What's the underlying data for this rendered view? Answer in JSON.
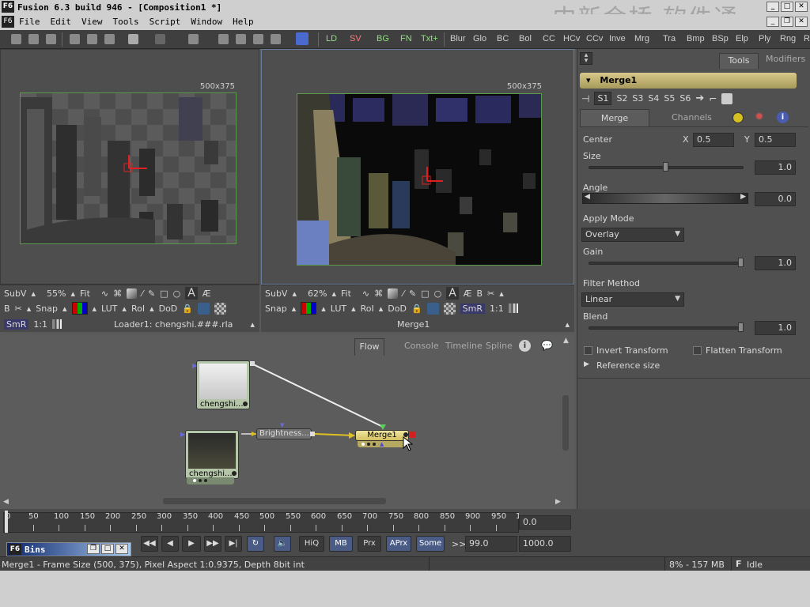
{
  "window": {
    "logo": "F6",
    "title": "Fusion 6.3 build 946 - [Composition1 *]",
    "watermark": "中新金桥  软件通"
  },
  "menu": {
    "logo": "F6",
    "items": [
      "File",
      "Edit",
      "View",
      "Tools",
      "Script",
      "Window",
      "Help"
    ]
  },
  "toolbar": {
    "green_tools": [
      "LD",
      "SV",
      "BG",
      "FN",
      "Txt+"
    ],
    "tools": [
      "Blur",
      "Glo",
      "BC",
      "Bol",
      "CC",
      "HCv",
      "CCv",
      "Inve",
      "Mrg",
      "Tra",
      "Bmp",
      "BSp",
      "Elp",
      "Ply",
      "Rng",
      "R"
    ]
  },
  "viewer_left": {
    "resolution": "500x375",
    "row1": {
      "subv": "SubV",
      "zoom": "55%",
      "fit": "Fit"
    },
    "row2": {
      "b": "B",
      "snap": "Snap",
      "lut": "LUT",
      "roi": "RoI",
      "dod": "DoD"
    },
    "row3": {
      "smr": "SmR",
      "one": "1:1",
      "name": "Loader1: chengshi.###.rla"
    }
  },
  "viewer_right": {
    "resolution": "500x375",
    "row1": {
      "subv": "SubV",
      "zoom": "62%",
      "fit": "Fit",
      "a": "A",
      "b": "B"
    },
    "row2": {
      "snap": "Snap",
      "lut": "LUT",
      "roi": "RoI",
      "dod": "DoD",
      "smr": "SmR",
      "one": "1:1"
    },
    "row3": {
      "name": "Merge1"
    }
  },
  "inspector": {
    "tabs": [
      "Tools",
      "Modifiers"
    ],
    "tool_name": "Merge1",
    "slots": [
      "S1",
      "S2",
      "S3",
      "S4",
      "S5",
      "S6"
    ],
    "subtabs": [
      "Merge",
      "Channels"
    ],
    "center": {
      "label": "Center",
      "x_label": "X",
      "x": "0.5",
      "y_label": "Y",
      "y": "0.5"
    },
    "size": {
      "label": "Size",
      "value": "1.0",
      "level": 0.5
    },
    "angle": {
      "label": "Angle",
      "value": "0.0"
    },
    "apply_mode": {
      "label": "Apply Mode",
      "value": "Overlay"
    },
    "gain": {
      "label": "Gain",
      "value": "1.0",
      "level": 1.0
    },
    "filter": {
      "label": "Filter Method",
      "value": "Linear"
    },
    "blend": {
      "label": "Blend",
      "value": "1.0",
      "level": 1.0
    },
    "invert": "Invert Transform",
    "flatten": "Flatten Transform",
    "refsize": "Reference size"
  },
  "flow": {
    "tabs": [
      "Flow",
      "Console",
      "Timeline",
      "Spline"
    ],
    "nodes": {
      "loader_top": "chengshi....",
      "loader_bottom": "chengshi....",
      "brightness": "Brightness...",
      "merge": "Merge1"
    }
  },
  "timeline": {
    "ticks": [
      "0",
      "50",
      "100",
      "150",
      "200",
      "250",
      "300",
      "350",
      "400",
      "450",
      "500",
      "550",
      "600",
      "650",
      "700",
      "750",
      "800",
      "850",
      "900",
      "950",
      "1"
    ],
    "current": "0.0",
    "buttons": [
      "HiQ",
      "MB",
      "Prx",
      "APrx",
      "Some"
    ],
    "chevrons": ">>",
    "end_a": "99.0",
    "end_b": "1000.0"
  },
  "bins": {
    "logo": "F6",
    "title": "Bins"
  },
  "status": {
    "info": "Merge1 - Frame Size (500, 375), Pixel Aspect 1:0.9375, Depth 8bit int",
    "memory": "8% - 157 MB",
    "state_logo": "F",
    "state": "Idle"
  }
}
